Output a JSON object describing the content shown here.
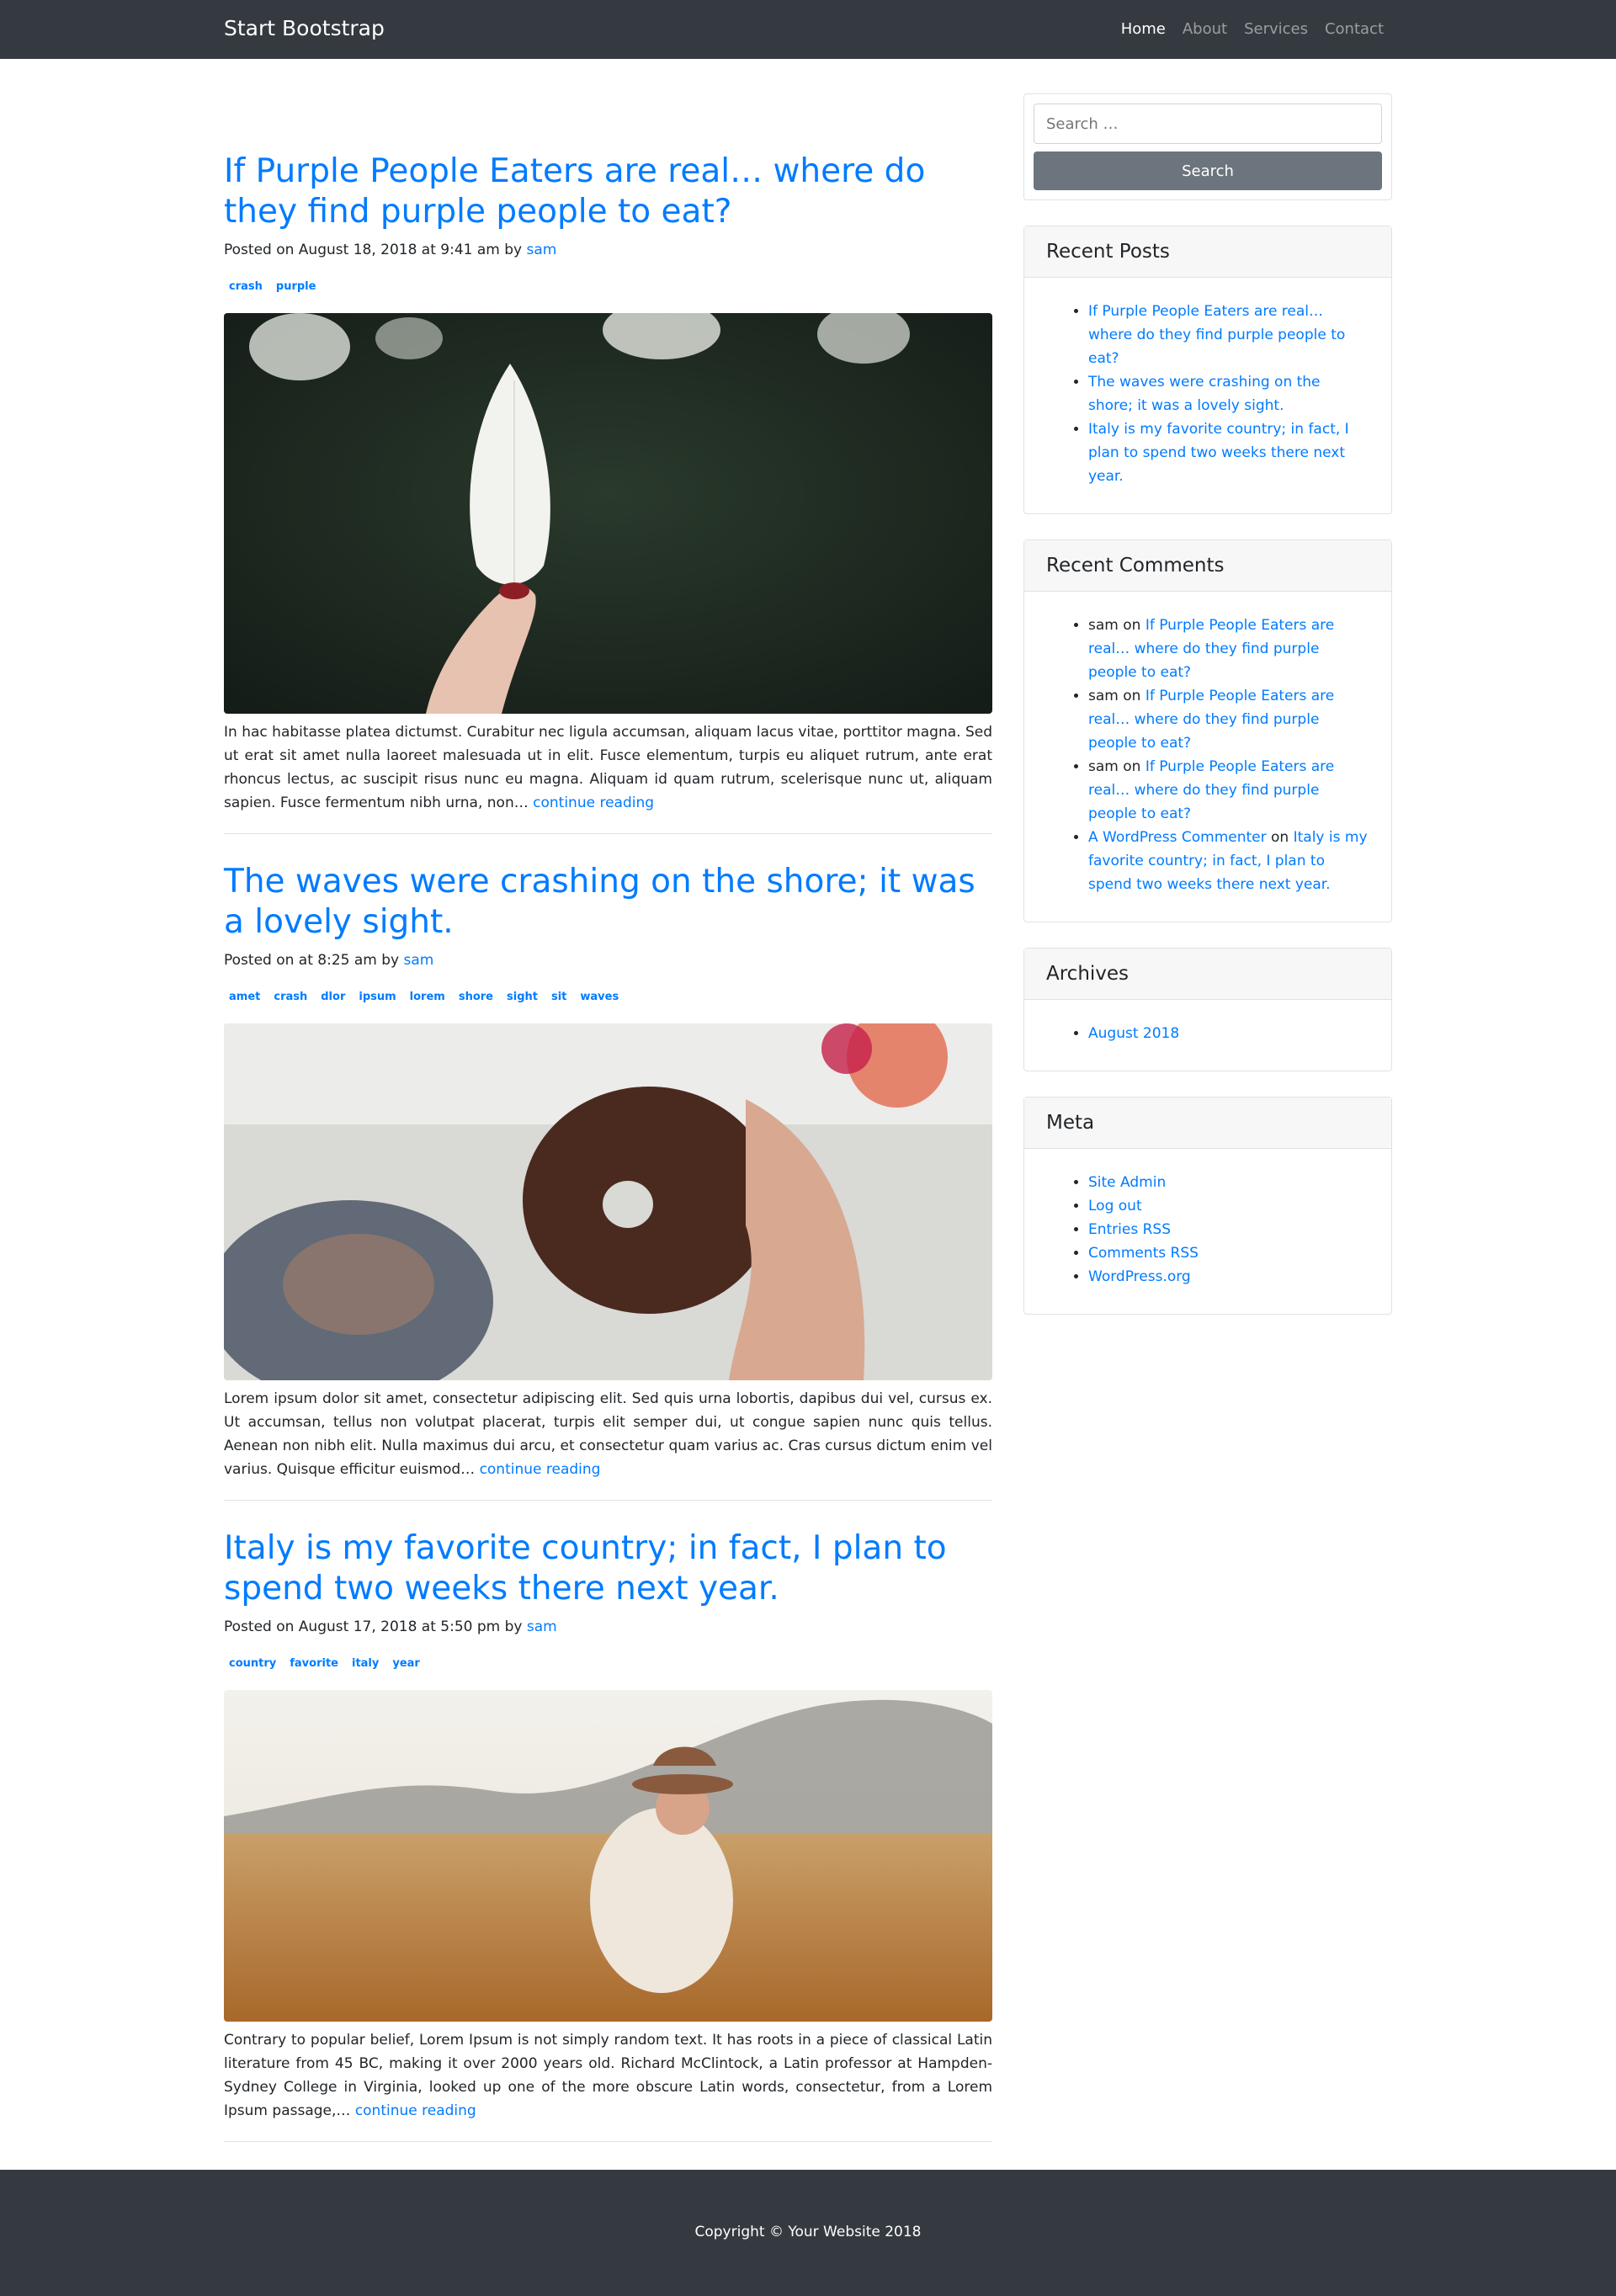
{
  "navbar": {
    "brand": "Start Bootstrap",
    "links": [
      "Home",
      "About",
      "Services",
      "Contact"
    ]
  },
  "posts": [
    {
      "title": "If Purple People Eaters are real… where do they find purple people to eat?",
      "meta_prefix": "Posted on August 18, 2018 at 9:41 am by ",
      "author": "sam",
      "tags": [
        "crash",
        "purple"
      ],
      "excerpt": "In hac habitasse platea dictumst. Curabitur nec ligula accumsan, aliquam lacus vitae, porttitor magna. Sed ut erat sit amet nulla laoreet malesuada ut in elit. Fusce elementum, turpis eu aliquet rutrum, ante erat rhoncus lectus, ac suscipit risus nunc eu magna. Aliquam id quam rutrum, scelerisque nunc ut, aliquam sapien. Fusce fermentum nibh urna, non… ",
      "continue": "continue reading"
    },
    {
      "title": "The waves were crashing on the shore; it was a lovely sight.",
      "meta_prefix": "Posted on at 8:25 am by ",
      "author": "sam",
      "tags": [
        "amet",
        "crash",
        "dlor",
        "ipsum",
        "lorem",
        "shore",
        "sight",
        "sit",
        "waves"
      ],
      "excerpt": "Lorem ipsum dolor sit amet, consectetur adipiscing elit. Sed quis urna lobortis, dapibus dui vel, cursus ex. Ut accumsan, tellus non volutpat placerat, turpis elit semper dui, ut congue sapien nunc quis tellus. Aenean non nibh elit. Nulla maximus dui arcu, et consectetur quam varius ac. Cras cursus dictum enim vel varius. Quisque efficitur euismod… ",
      "continue": "continue reading"
    },
    {
      "title": "Italy is my favorite country; in fact, I plan to spend two weeks there next year.",
      "meta_prefix": "Posted on August 17, 2018 at 5:50 pm by ",
      "author": "sam",
      "tags": [
        "country",
        "favorite",
        "italy",
        "year"
      ],
      "excerpt": "Contrary to popular belief, Lorem Ipsum is not simply random text. It has roots in a piece of classical Latin literature from 45 BC, making it over 2000 years old. Richard McClintock, a Latin professor at Hampden-Sydney College in Virginia, looked up one of the more obscure Latin words, consectetur, from a Lorem Ipsum passage,… ",
      "continue": "continue reading"
    }
  ],
  "sidebar": {
    "search_placeholder": "Search …",
    "search_button": "Search",
    "recent_posts_title": "Recent Posts",
    "recent_posts": [
      "If Purple People Eaters are real… where do they find purple people to eat?",
      "The waves were crashing on the shore; it was a lovely sight.",
      "Italy is my favorite country; in fact, I plan to spend two weeks there next year."
    ],
    "recent_comments_title": "Recent Comments",
    "recent_comments": [
      {
        "author": "sam",
        "on": " on ",
        "post": "If Purple People Eaters are real… where do they find purple people to eat?"
      },
      {
        "author": "sam",
        "on": " on ",
        "post": "If Purple People Eaters are real… where do they find purple people to eat?"
      },
      {
        "author": "sam",
        "on": " on ",
        "post": "If Purple People Eaters are real… where do they find purple people to eat?"
      },
      {
        "author": "A WordPress Commenter",
        "on": " on ",
        "post": "Italy is my favorite country; in fact, I plan to spend two weeks there next year."
      }
    ],
    "archives_title": "Archives",
    "archives": [
      "August 2018"
    ],
    "meta_title": "Meta",
    "meta_links": [
      "Site Admin",
      "Log out",
      "Entries RSS",
      "Comments RSS",
      "WordPress.org"
    ]
  },
  "footer": {
    "copyright": "Copyright © Your Website 2018"
  },
  "colors": {
    "navbar_bg": "#343a40",
    "link": "#007bff",
    "button_bg": "#6c757d"
  }
}
